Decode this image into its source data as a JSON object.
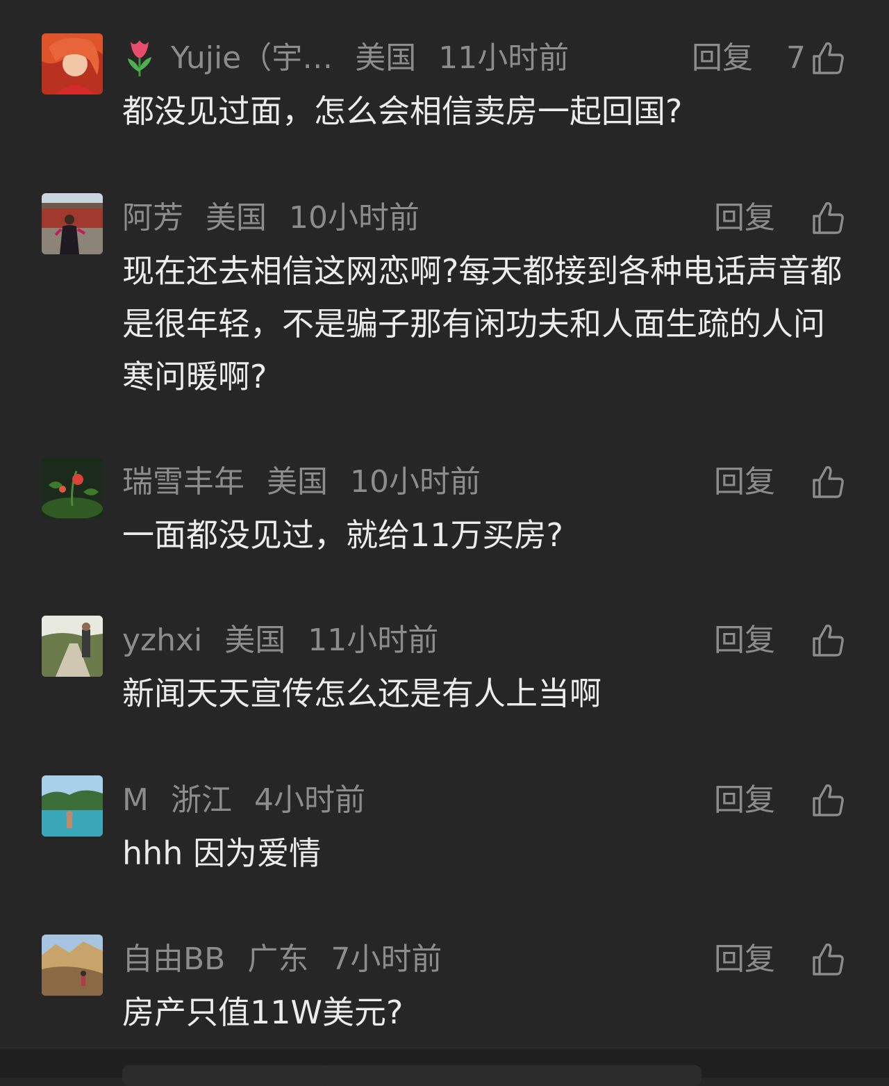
{
  "comments": [
    {
      "username": "Yujie（宇…",
      "location": "美国",
      "time": "11小时前",
      "reply_label": "回复",
      "like_count": "7",
      "text": "都没见过面，怎么会相信卖房一起回国?"
    },
    {
      "username": "阿芳",
      "location": "美国",
      "time": "10小时前",
      "reply_label": "回复",
      "like_count": "",
      "text": "现在还去相信这网恋啊?每天都接到各种电话声音都是很年轻，不是骗子那有闲功夫和人面生疏的人问寒问暖啊?"
    },
    {
      "username": "瑞雪丰年",
      "location": "美国",
      "time": "10小时前",
      "reply_label": "回复",
      "like_count": "",
      "text": "一面都没见过，就给11万买房?"
    },
    {
      "username": "yzhxi",
      "location": "美国",
      "time": "11小时前",
      "reply_label": "回复",
      "like_count": "",
      "text": "新闻天天宣传怎么还是有人上当啊"
    },
    {
      "username": "M",
      "location": "浙江",
      "time": "4小时前",
      "reply_label": "回复",
      "like_count": "",
      "text": "hhh 因为爱情"
    },
    {
      "username": "自由BB",
      "location": "广东",
      "time": "7小时前",
      "reply_label": "回复",
      "like_count": "",
      "text": "房产只值11W美元?"
    }
  ],
  "icons": {
    "like": "thumbs-up-icon",
    "name_prefix": "tulip-icon"
  },
  "colors": {
    "background": "#262626",
    "meta_text": "#8c8c8c",
    "body_text": "#ececec"
  }
}
